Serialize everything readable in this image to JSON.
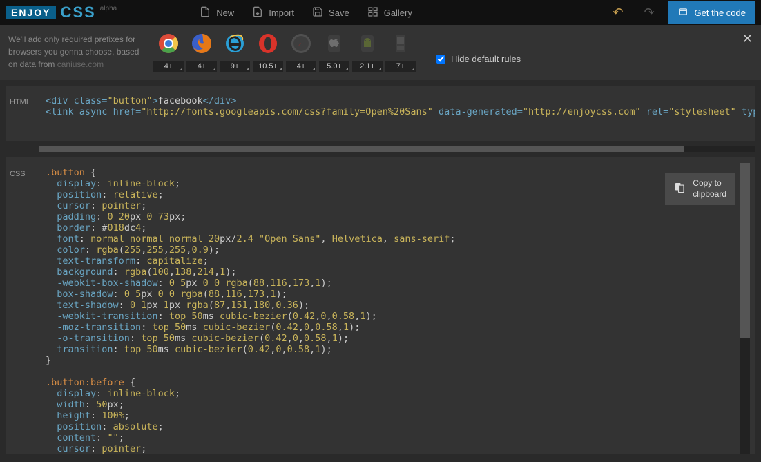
{
  "logo": {
    "enjoy": "ENJOY",
    "css": "CSS",
    "alpha": "alpha"
  },
  "nav": [
    {
      "label": "New",
      "icon": "new"
    },
    {
      "label": "Import",
      "icon": "import"
    },
    {
      "label": "Save",
      "icon": "save"
    },
    {
      "label": "Gallery",
      "icon": "gallery"
    }
  ],
  "get_code": "Get the code",
  "prefix_text": {
    "line1": "We'll add only required prefixes for browsers you gonna choose, based on data from ",
    "link": "caniuse.com"
  },
  "browsers": [
    {
      "name": "chrome",
      "ver": "4+",
      "color": "#f2c54a",
      "active": true
    },
    {
      "name": "firefox",
      "ver": "4+",
      "color": "#e67817",
      "active": true
    },
    {
      "name": "ie",
      "ver": "9+",
      "color": "#2a9fd6",
      "active": true
    },
    {
      "name": "opera",
      "ver": "10.5+",
      "color": "#d9332a",
      "active": true
    },
    {
      "name": "safari",
      "ver": "4+",
      "color": "#888",
      "active": false
    },
    {
      "name": "ios",
      "ver": "5.0+",
      "color": "#888",
      "active": false
    },
    {
      "name": "android",
      "ver": "2.1+",
      "color": "#888",
      "active": false
    },
    {
      "name": "blackberry",
      "ver": "7+",
      "color": "#888",
      "active": false
    }
  ],
  "hide_default": "Hide default rules",
  "panes": {
    "html_label": "HTML",
    "css_label": "CSS",
    "copy": "Copy to\nclipboard"
  },
  "html_code": {
    "class_val": "button",
    "text": "facebook",
    "href": "http://fonts.googleapis.com/css?family=Open%20Sans",
    "data_generated": "http://enjoycss.com",
    "rel": "stylesheet"
  },
  "css_code": {
    "selector1": ".button",
    "selector2": ".button:before",
    "rules1": [
      {
        "p": "display",
        "v": "inline-block"
      },
      {
        "p": "position",
        "v": "relative"
      },
      {
        "p": "cursor",
        "v": "pointer"
      },
      {
        "p": "padding",
        "v": "0 20px 0 73px"
      },
      {
        "p": "border",
        "v": "#018dc4"
      },
      {
        "p": "font",
        "v": "normal normal normal 20px/2.4 \"Open Sans\", Helvetica, sans-serif"
      },
      {
        "p": "color",
        "v": "rgba(255,255,255,0.9)"
      },
      {
        "p": "text-transform",
        "v": "capitalize"
      },
      {
        "p": "background",
        "v": "rgba(100,138,214,1)"
      },
      {
        "p": "-webkit-box-shadow",
        "v": "0 5px 0 0 rgba(88,116,173,1)"
      },
      {
        "p": "box-shadow",
        "v": "0 5px 0 0 rgba(88,116,173,1)"
      },
      {
        "p": "text-shadow",
        "v": "0 1px 1px rgba(87,151,180,0.36)"
      },
      {
        "p": "-webkit-transition",
        "v": "top 50ms cubic-bezier(0.42,0,0.58,1)"
      },
      {
        "p": "-moz-transition",
        "v": "top 50ms cubic-bezier(0.42,0,0.58,1)"
      },
      {
        "p": "-o-transition",
        "v": "top 50ms cubic-bezier(0.42,0,0.58,1)"
      },
      {
        "p": "transition",
        "v": "top 50ms cubic-bezier(0.42,0,0.58,1)"
      }
    ],
    "rules2": [
      {
        "p": "display",
        "v": "inline-block"
      },
      {
        "p": "width",
        "v": "50px"
      },
      {
        "p": "height",
        "v": "100%"
      },
      {
        "p": "position",
        "v": "absolute"
      },
      {
        "p": "content",
        "v": "\"\""
      },
      {
        "p": "cursor",
        "v": "pointer"
      }
    ]
  }
}
